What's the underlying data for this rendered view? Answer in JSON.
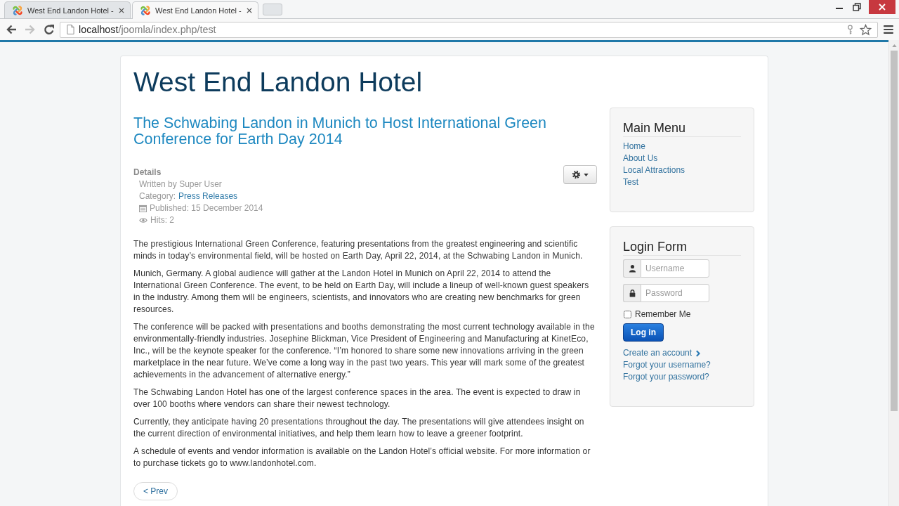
{
  "browser": {
    "tabs": [
      {
        "title": "West End Landon Hotel -",
        "selected": false
      },
      {
        "title": "West End Landon Hotel -",
        "selected": true
      }
    ],
    "nav_buttons": [
      {
        "kind": "back",
        "disabled": false
      },
      {
        "kind": "forward",
        "disabled": true
      },
      {
        "kind": "reload",
        "disabled": false
      }
    ],
    "address": {
      "host": "localhost",
      "path": "/joomla/index.php/test"
    }
  },
  "site_title": "West End Landon Hotel",
  "article": {
    "title": "The Schwabing Landon in Munich to Host International Green Conference for Earth Day 2014",
    "details": {
      "heading": "Details",
      "items": [
        {
          "kind": "author",
          "text": "Written by Super User"
        },
        {
          "kind": "category",
          "label": "Category:",
          "link": "Press Releases"
        },
        {
          "kind": "published",
          "text": "Published: 15 December 2014"
        },
        {
          "kind": "hits",
          "text": "Hits: 2"
        }
      ]
    },
    "paragraphs": [
      "The prestigious International Green Conference, featuring presentations from the greatest engineering and scientific minds in today’s environmental field, will be hosted on Earth Day, April 22, 2014, at the Schwabing Landon in Munich.",
      "Munich, Germany. A global audience will gather at the Landon Hotel in Munich on April 22, 2014 to attend the International Green Conference. The event, to be held on Earth Day, will include a lineup of well-known guest speakers in the industry. Among them will be engineers, scientists, and innovators who are creating new benchmarks for green resources.",
      "The conference will be packed with presentations and booths demonstrating the most current technology available in the environmentally-friendly industries. Josephine Blickman, Vice President of Engineering and Manufacturing at KinetEco, Inc., will be the keynote speaker for the conference. “I’m honored to share some new innovations arriving in the green marketplace in the near future. We’ve come a long way in the past two years. This year will mark some of the greatest achievements in the advancement of alternative energy.”",
      "The Schwabing Landon Hotel has one of the largest conference spaces in the area. The event is expected to draw in over 100 booths where vendors can share their newest technology.",
      "Currently, they anticipate having 20 presentations throughout the day. The presentations will give attendees insight on the current direction of environmental initiatives, and help them learn how to leave a greener footprint.",
      "A schedule of events and vendor information is available on the Landon Hotel’s official website. For more information or to purchase tickets go to www.landonhotel.com."
    ],
    "pager": {
      "prev": "< Prev"
    }
  },
  "sidebar": {
    "main_menu": {
      "title": "Main Menu",
      "items": [
        "Home",
        "About Us",
        "Local Attractions",
        "Test"
      ]
    },
    "login": {
      "title": "Login Form",
      "username": {
        "placeholder": "Username"
      },
      "password": {
        "placeholder": "Password"
      },
      "remember": {
        "label": "Remember Me",
        "checked": false
      },
      "submit": "Log in",
      "create_account": "Create an account",
      "links": [
        "Forgot your username?",
        "Forgot your password?"
      ]
    }
  }
}
